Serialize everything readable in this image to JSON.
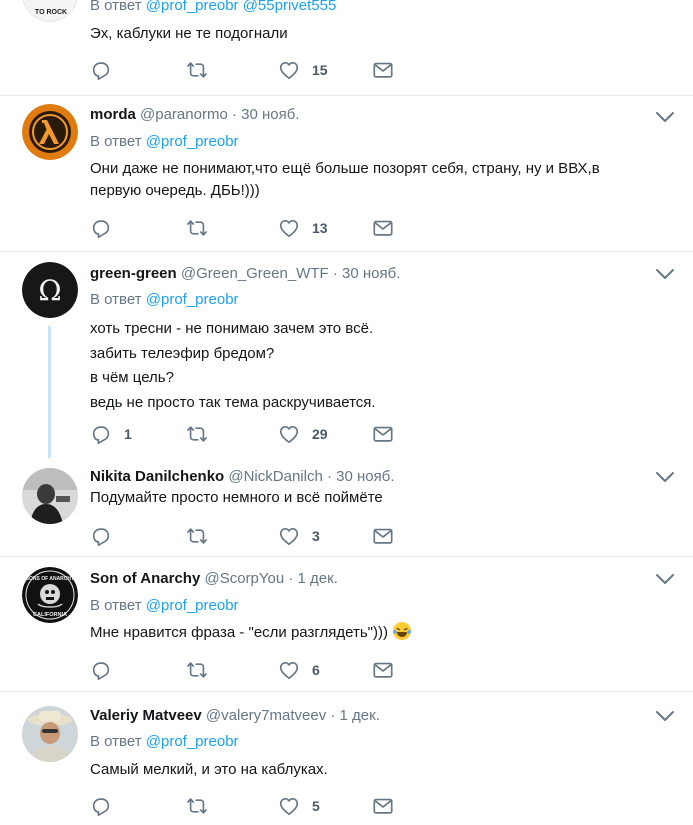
{
  "tweets": [
    {
      "reply_prefix": "В ответ",
      "mentions": [
        "@prof_preobr",
        "@55privet555"
      ],
      "text": [
        "Эх, каблуки не те подогнали"
      ],
      "replies": "",
      "likes": "15"
    },
    {
      "name": "morda",
      "handle": "@paranormo",
      "time": "30 нояб.",
      "reply_prefix": "В ответ",
      "mention": "@prof_preobr",
      "text": [
        "Они даже не понимают,что ещё больше позорят себя, страну, ну и ВВХ,в",
        "первую очередь. ДБЬ!)))"
      ],
      "replies": "",
      "likes": "13"
    },
    {
      "name": "green-green",
      "handle": "@Green_Green_WTF",
      "time": "30 нояб.",
      "reply_prefix": "В ответ",
      "mention": "@prof_preobr",
      "text": [
        "хоть тресни - не понимаю зачем это всё.",
        "забить телеэфир бредом?",
        "в чём цель?",
        "ведь не просто так тема раскручивается."
      ],
      "replies": "1",
      "likes": "29"
    },
    {
      "name": "Nikita Danilchenko",
      "handle": "@NickDanilch",
      "time": "30 нояб.",
      "text": [
        "Подумайте просто немного и всё поймёте"
      ],
      "replies": "",
      "likes": "3"
    },
    {
      "name": "Son of Anarchy",
      "handle": "@ScorpYou",
      "time": "1 дек.",
      "reply_prefix": "В ответ",
      "mention": "@prof_preobr",
      "text": [
        "Мне нравится фраза - \"если разглядеть\")))"
      ],
      "replies": "",
      "likes": "6"
    },
    {
      "name": "Valeriy Matveev",
      "handle": "@valery7matveev",
      "time": "1 дек.",
      "reply_prefix": "В ответ",
      "mention": "@prof_preobr",
      "text": [
        "Самый мелкий, и это на каблуках."
      ],
      "replies": "",
      "likes": "5"
    }
  ],
  "avatars": {
    "t0": "rock-band-logo",
    "t1": "half-life-lambda-logo",
    "t2": "omega-symbol-logo",
    "t3": "bw-photo-man",
    "t4": "sons-of-anarchy-california-patch",
    "t5": "man-in-hat-photo"
  },
  "avatar_texts": {
    "t0": "TO ROCK",
    "t4_top": "SONS OF ANARCHY",
    "t4_bottom": "CALIFORNIA"
  },
  "sep": "·",
  "colors": {
    "accent": "#1da1f2",
    "text": "#14171a",
    "muted": "#657786",
    "icon": "#657786",
    "border": "#e6ecf0"
  }
}
